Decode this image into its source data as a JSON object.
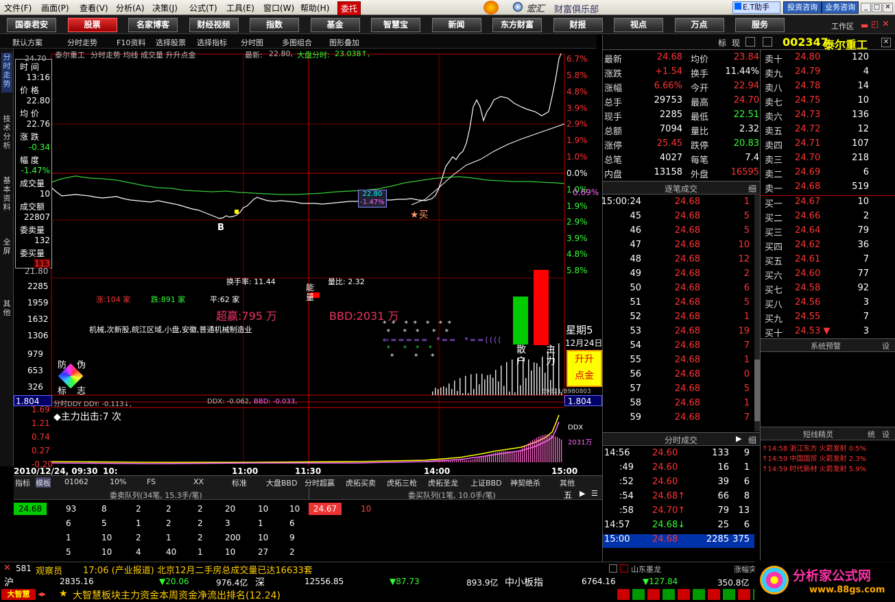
{
  "menu": [
    "文件(F)",
    "画面(P)",
    "查看(V)",
    "分析(A)",
    "决策(J)",
    "公式(T)",
    "工具(E)",
    "窗口(W)",
    "帮助(H)"
  ],
  "menu_btn": "委托",
  "brand": "财富俱乐部",
  "brand_logo": "宏汇",
  "topright": [
    "E.T助手",
    "投资咨询",
    "业务咨询"
  ],
  "toolbar": [
    "国泰君安",
    "股票",
    "名家博客",
    "财经视频",
    "指数",
    "基金",
    "智慧宝",
    "新闻",
    "东方财富",
    "财报",
    "视点",
    "万点",
    "服务"
  ],
  "toolbar_active": 1,
  "subbar": [
    "默认方案",
    "分时走势",
    "F10资料",
    "选择股票",
    "选择指标",
    "分时图",
    "多图组合",
    "图形叠加"
  ],
  "lefttabs": [
    "分时走势",
    "技术分析",
    "基本资料",
    "全屏",
    "其他"
  ],
  "chart_header": {
    "stock": "泰尔重工",
    "items": "分时走势 均线 成交量 升升点金",
    "latest_label": "最新:",
    "latest": "22.80,",
    "market_label": "大盘分时:",
    "market": "23.038↑,"
  },
  "info_box": [
    [
      "时 间",
      "13:16"
    ],
    [
      "价 格",
      "22.80"
    ],
    [
      "均 价",
      "22.76"
    ],
    [
      "涨 跌",
      "-0.34"
    ],
    [
      "幅 度",
      "-1.47%"
    ],
    [
      "成交量",
      "10"
    ],
    [
      "成交额",
      "22807"
    ],
    [
      "委卖量",
      "132"
    ],
    [
      "委买量",
      "113"
    ]
  ],
  "price_axis_left": [
    "24.70",
    "21.80"
  ],
  "pct_axis": [
    "6.7%",
    "5.8%",
    "4.8%",
    "3.9%",
    "2.9%",
    "1.9%",
    "1.0%",
    "0.0%",
    "1.0%",
    "1.9%",
    "2.9%",
    "3.9%",
    "4.8%",
    "5.8%"
  ],
  "pct_highlight": "0.69%",
  "cursor_box": [
    "22.80",
    "-1.47%"
  ],
  "marks": {
    "b": "B",
    "buy": "★买"
  },
  "vol_axis": [
    "2285",
    "1959",
    "1632",
    "1306",
    "979",
    "653",
    "326",
    "1.804"
  ],
  "stats": {
    "turnover": "换手率: 11.44",
    "vol_ratio": "量比: 2.32",
    "up": "涨:104 家",
    "down": "跌:891 家",
    "flat": "平:62 家",
    "energy": "能量",
    "super": "超赢:795 万",
    "bbd": "BBD:2031 万",
    "sectors": "机械,次新股,皖江区域,小盘,安徽,普通机械制造业"
  },
  "anti_fake": [
    "防",
    "伪",
    "标",
    "志"
  ],
  "side": {
    "weekday": "星期5",
    "date": "12月24日",
    "retail": "散户",
    "main": "主力",
    "golden": [
      "升升",
      "点金"
    ]
  },
  "vol_readout": "89811/8980803",
  "ddy_bar": {
    "left": "1.804",
    "label": "分时DDY  DDY: -0.113↓,",
    "ddx": "DDX: -0.062,",
    "bbd": "BBD: -0.033,",
    "right": "1.804"
  },
  "ddy_axis": [
    "1.69",
    "1.21",
    "0.74",
    "0.27",
    "-0.20"
  ],
  "main_strike": "◆主力出击:7 次",
  "ddy_side": [
    "DDX",
    "2031万"
  ],
  "time_axis": [
    "2010/12/24, 09:30",
    "10:",
    "11:00",
    "11:30",
    "14:00",
    "15:00"
  ],
  "bottom_tabs": [
    "指标",
    "模板",
    "01062",
    "10%",
    "FS",
    "XX",
    "标准",
    "大盘BBD",
    "分时超赢",
    "虎拓买卖",
    "虎拓三枪",
    "虎拓圣龙",
    "上证BBD",
    "神契绝杀",
    "其他"
  ],
  "sell_queue_title": "委卖队列(34笔, 15.3手/笔)",
  "buy_queue_title": "委买队列(1笔, 10.0手/笔)",
  "queue_btn": "五",
  "sell_queue": [
    [
      "24.68",
      "93",
      "8",
      "2",
      "2",
      "2",
      "20",
      "10",
      "10"
    ],
    [
      "",
      "6",
      "5",
      "1",
      "2",
      "2",
      "3",
      "1",
      "6"
    ],
    [
      "",
      "1",
      "10",
      "2",
      "1",
      "2",
      "200",
      "10",
      "9"
    ],
    [
      "",
      "5",
      "10",
      "4",
      "40",
      "1",
      "10",
      "27",
      "2"
    ]
  ],
  "buy_queue": [
    [
      "24.67",
      "10"
    ]
  ],
  "quote_header": {
    "code": "002347",
    "name": "泰尔重工",
    "tabs": [
      "标",
      "现"
    ]
  },
  "quote_left": [
    [
      "最新",
      "24.68",
      "均价",
      "23.84"
    ],
    [
      "涨跌",
      "+1.54",
      "换手",
      "11.44%"
    ],
    [
      "涨幅",
      "6.66%",
      "今开",
      "22.94"
    ],
    [
      "总手",
      "29753",
      "最高",
      "24.70"
    ],
    [
      "现手",
      "2285",
      "最低",
      "22.51"
    ],
    [
      "总额",
      "7094",
      "量比",
      "2.32"
    ],
    [
      "涨停",
      "25.45",
      "跌停",
      "20.83"
    ],
    [
      "总笔",
      "4027",
      "每笔",
      "7.4"
    ],
    [
      "内盘",
      "13158",
      "外盘",
      "16595"
    ]
  ],
  "tick_title": "逐笔成交",
  "tick_btn": "细",
  "ticks": [
    [
      "15:00:24",
      "24.68",
      "1"
    ],
    [
      "45",
      "24.68",
      "5"
    ],
    [
      "46",
      "24.68",
      "5"
    ],
    [
      "47",
      "24.68",
      "10"
    ],
    [
      "48",
      "24.68",
      "12"
    ],
    [
      "49",
      "24.68",
      "2"
    ],
    [
      "50",
      "24.68",
      "6"
    ],
    [
      "51",
      "24.68",
      "5"
    ],
    [
      "52",
      "24.68",
      "1"
    ],
    [
      "53",
      "24.68",
      "19"
    ],
    [
      "54",
      "24.68",
      "7"
    ],
    [
      "55",
      "24.68",
      "1"
    ],
    [
      "56",
      "24.68",
      "0"
    ],
    [
      "57",
      "24.68",
      "5"
    ],
    [
      "58",
      "24.68",
      "1"
    ],
    [
      "59",
      "24.68",
      "7"
    ]
  ],
  "min_title": "分时成交",
  "mins": [
    [
      "14:56",
      "24.60",
      "133",
      "9",
      ""
    ],
    [
      ":49",
      "24.60",
      "16",
      "1",
      ""
    ],
    [
      ":52",
      "24.60",
      "39",
      "6",
      ""
    ],
    [
      ":54",
      "24.68↑",
      "66",
      "8",
      "r"
    ],
    [
      ":58",
      "24.70↑",
      "79",
      "13",
      "r"
    ],
    [
      "14:57",
      "24.68↓",
      "25",
      "6",
      "g"
    ],
    [
      "15:00",
      "24.68",
      "2285",
      "375",
      "sel"
    ]
  ],
  "sells": [
    [
      "卖十",
      "24.80",
      "120"
    ],
    [
      "卖九",
      "24.79",
      "4"
    ],
    [
      "卖八",
      "24.78",
      "14"
    ],
    [
      "卖七",
      "24.75",
      "10"
    ],
    [
      "卖六",
      "24.73",
      "136"
    ],
    [
      "卖五",
      "24.72",
      "12"
    ],
    [
      "卖四",
      "24.71",
      "107"
    ],
    [
      "卖三",
      "24.70",
      "218"
    ],
    [
      "卖二",
      "24.69",
      "6"
    ],
    [
      "卖一",
      "24.68",
      "519"
    ]
  ],
  "buys": [
    [
      "买一",
      "24.67",
      "10"
    ],
    [
      "买二",
      "24.66",
      "2"
    ],
    [
      "买三",
      "24.64",
      "79"
    ],
    [
      "买四",
      "24.62",
      "36"
    ],
    [
      "买五",
      "24.61",
      "7"
    ],
    [
      "买六",
      "24.60",
      "77"
    ],
    [
      "买七",
      "24.58",
      "92"
    ],
    [
      "买八",
      "24.56",
      "3"
    ],
    [
      "买九",
      "24.55",
      "7"
    ],
    [
      "买十",
      "24.53 ▼",
      "3"
    ]
  ],
  "alert_title": "系统预警",
  "alert_btn": "设",
  "elf_title": "短线精灵",
  "elf_btns": [
    "统",
    "设"
  ],
  "elf": [
    "↑14:58 浙江东方 火箭发射 0.5%",
    "↑14:59 中国国贸 火箭发射 2.3%",
    "↑14:59 时代新材 火箭发射 5.9%"
  ],
  "news": {
    "count": "581",
    "who": "观察员",
    "text": "17:06 (产业报道) 北京12月二手房总成交量已达16633套",
    "right": "山东墨龙",
    "right2": "涨幅突"
  },
  "index": {
    "sh": "沪",
    "sh_val": "2835.16",
    "sh_chg": "▼20.06",
    "sh_amt": "976.4亿",
    "sz": "深",
    "sz_val": "12556.85",
    "sz_chg": "▼87.73",
    "sz_amt": "893.9亿",
    "sme": "中小板指",
    "sme_val": "6764.16",
    "sme_chg": "▼127.84",
    "sme_amt": "350.8亿"
  },
  "ticker": {
    "tag": "大智慧",
    "text": "大智慧板块主力资金本周资金净流出排名(12.24)"
  },
  "watermark": {
    "title": "分析家公式网",
    "url": "www.88gs.com"
  },
  "workspace": "工作区"
}
